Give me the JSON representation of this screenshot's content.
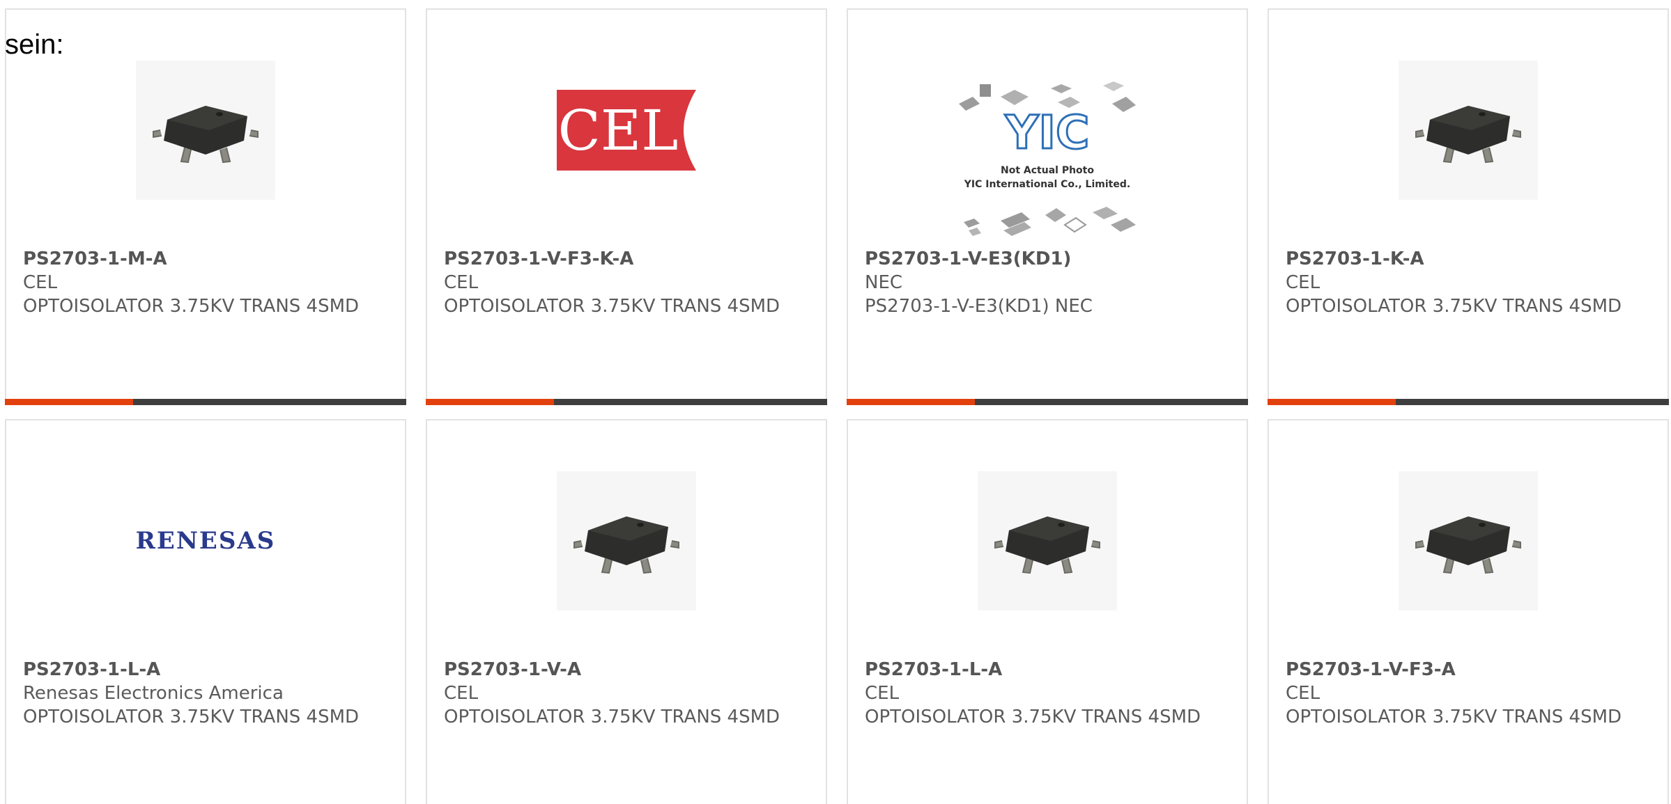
{
  "page": {
    "intro_text": "sein:"
  },
  "colors": {
    "accent": "#e2400d",
    "bar_dark": "#3e3e3e",
    "card_border": "#e2e2e2",
    "text": "#5a5a5a"
  },
  "products": [
    {
      "part_number": "PS2703-1-M-A",
      "manufacturer": "CEL",
      "description": "OPTOISOLATOR 3.75KV TRANS 4SMD",
      "image": "smd-chip-photo"
    },
    {
      "part_number": "PS2703-1-V-F3-K-A",
      "manufacturer": "CEL",
      "description": "OPTOISOLATOR 3.75KV TRANS 4SMD",
      "image": "cel-logo",
      "logo_text": "CEL"
    },
    {
      "part_number": "PS2703-1-V-E3(KD1)",
      "manufacturer": "NEC",
      "description": "PS2703-1-V-E3(KD1) NEC",
      "image": "yic-placeholder",
      "logo_text": "YIC",
      "photo_caption_1": "Not Actual Photo",
      "photo_caption_2": "YIC International Co., Limited."
    },
    {
      "part_number": "PS2703-1-K-A",
      "manufacturer": "CEL",
      "description": "OPTOISOLATOR 3.75KV TRANS 4SMD",
      "image": "smd-chip-photo"
    },
    {
      "part_number": "PS2703-1-L-A",
      "manufacturer": "Renesas Electronics America",
      "description": "OPTOISOLATOR 3.75KV TRANS 4SMD",
      "image": "renesas-logo",
      "logo_text": "RENESAS"
    },
    {
      "part_number": "PS2703-1-V-A",
      "manufacturer": "CEL",
      "description": "OPTOISOLATOR 3.75KV TRANS 4SMD",
      "image": "smd-chip-photo"
    },
    {
      "part_number": "PS2703-1-L-A",
      "manufacturer": "CEL",
      "description": "OPTOISOLATOR 3.75KV TRANS 4SMD",
      "image": "smd-chip-photo"
    },
    {
      "part_number": "PS2703-1-V-F3-A",
      "manufacturer": "CEL",
      "description": "OPTOISOLATOR 3.75KV TRANS 4SMD",
      "image": "smd-chip-photo"
    }
  ]
}
